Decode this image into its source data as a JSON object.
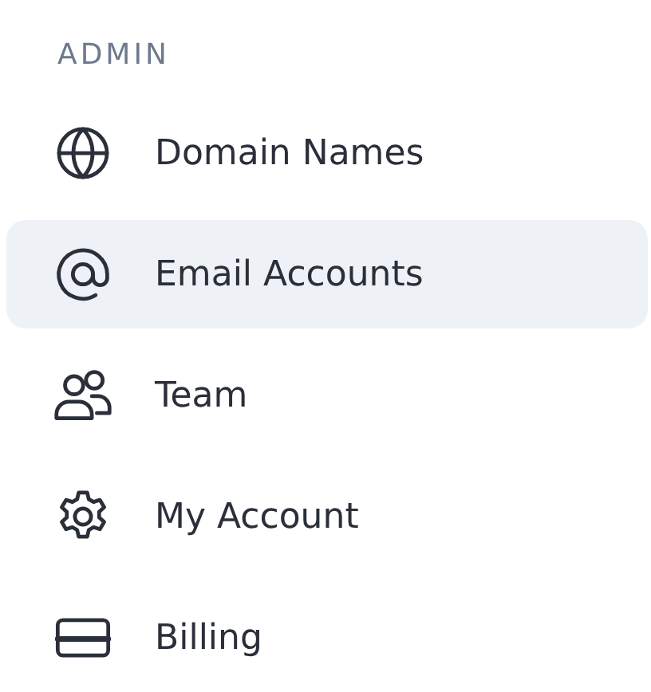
{
  "section_title": "ADMIN",
  "items": [
    {
      "label": "Domain Names",
      "selected": false
    },
    {
      "label": "Email Accounts",
      "selected": true
    },
    {
      "label": "Team",
      "selected": false
    },
    {
      "label": "My Account",
      "selected": false
    },
    {
      "label": "Billing",
      "selected": false
    }
  ]
}
